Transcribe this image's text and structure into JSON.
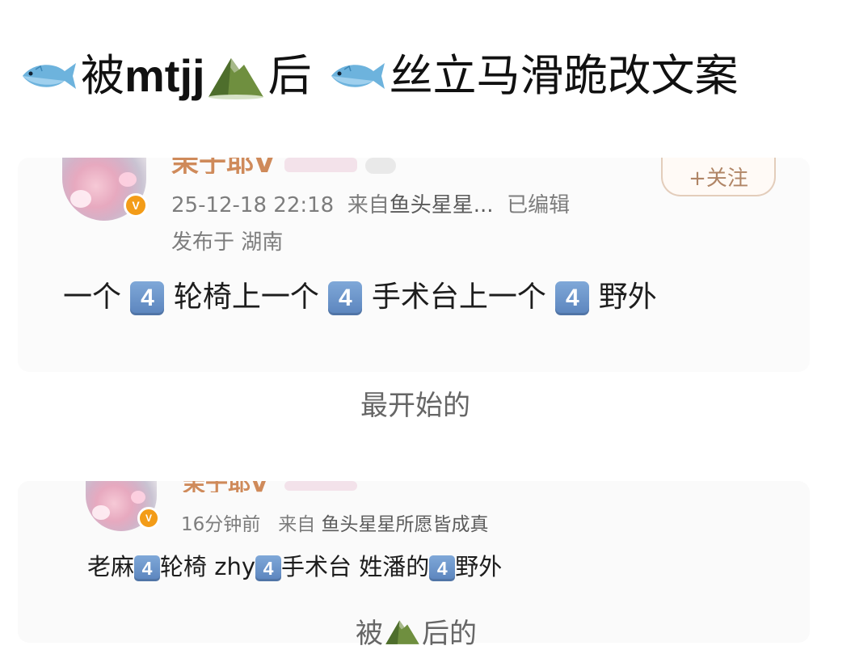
{
  "title": {
    "part1_icon": "fish-emoji",
    "part1_text": "被",
    "part1_latin": "mtjj",
    "part2_icon": "mountain-emoji",
    "part2_text": "后",
    "part3_icon": "fish-emoji",
    "part3_text": "丝立马滑跪改文案"
  },
  "post1": {
    "username_cut": "茉于耶V",
    "timestamp": "25-12-18 22:18",
    "source_prefix": "来自",
    "source_name": "鱼头星星...",
    "edited": "已编辑",
    "location": "发布于 湖南",
    "follow_label": "+关注",
    "segments": [
      "一个",
      "4",
      "轮椅上一个",
      "4",
      "手术台上一个",
      "4",
      "野外"
    ]
  },
  "caption1": "最开始的",
  "post2": {
    "username_cut": "茉于耶V",
    "time": "16分钟前",
    "source_prefix": "来自",
    "source_name": "鱼头星星所愿皆成真",
    "segments": [
      "老麻",
      "4",
      "轮椅 zhy",
      "4",
      "手术台 姓潘的",
      "4",
      "野外"
    ]
  },
  "caption2": {
    "prefix": "被",
    "icon": "mountain-emoji",
    "suffix": "后的"
  },
  "colors": {
    "badge": "#f39c18",
    "keycap": "#6a93c9",
    "source_link": "#5b5b5b"
  }
}
